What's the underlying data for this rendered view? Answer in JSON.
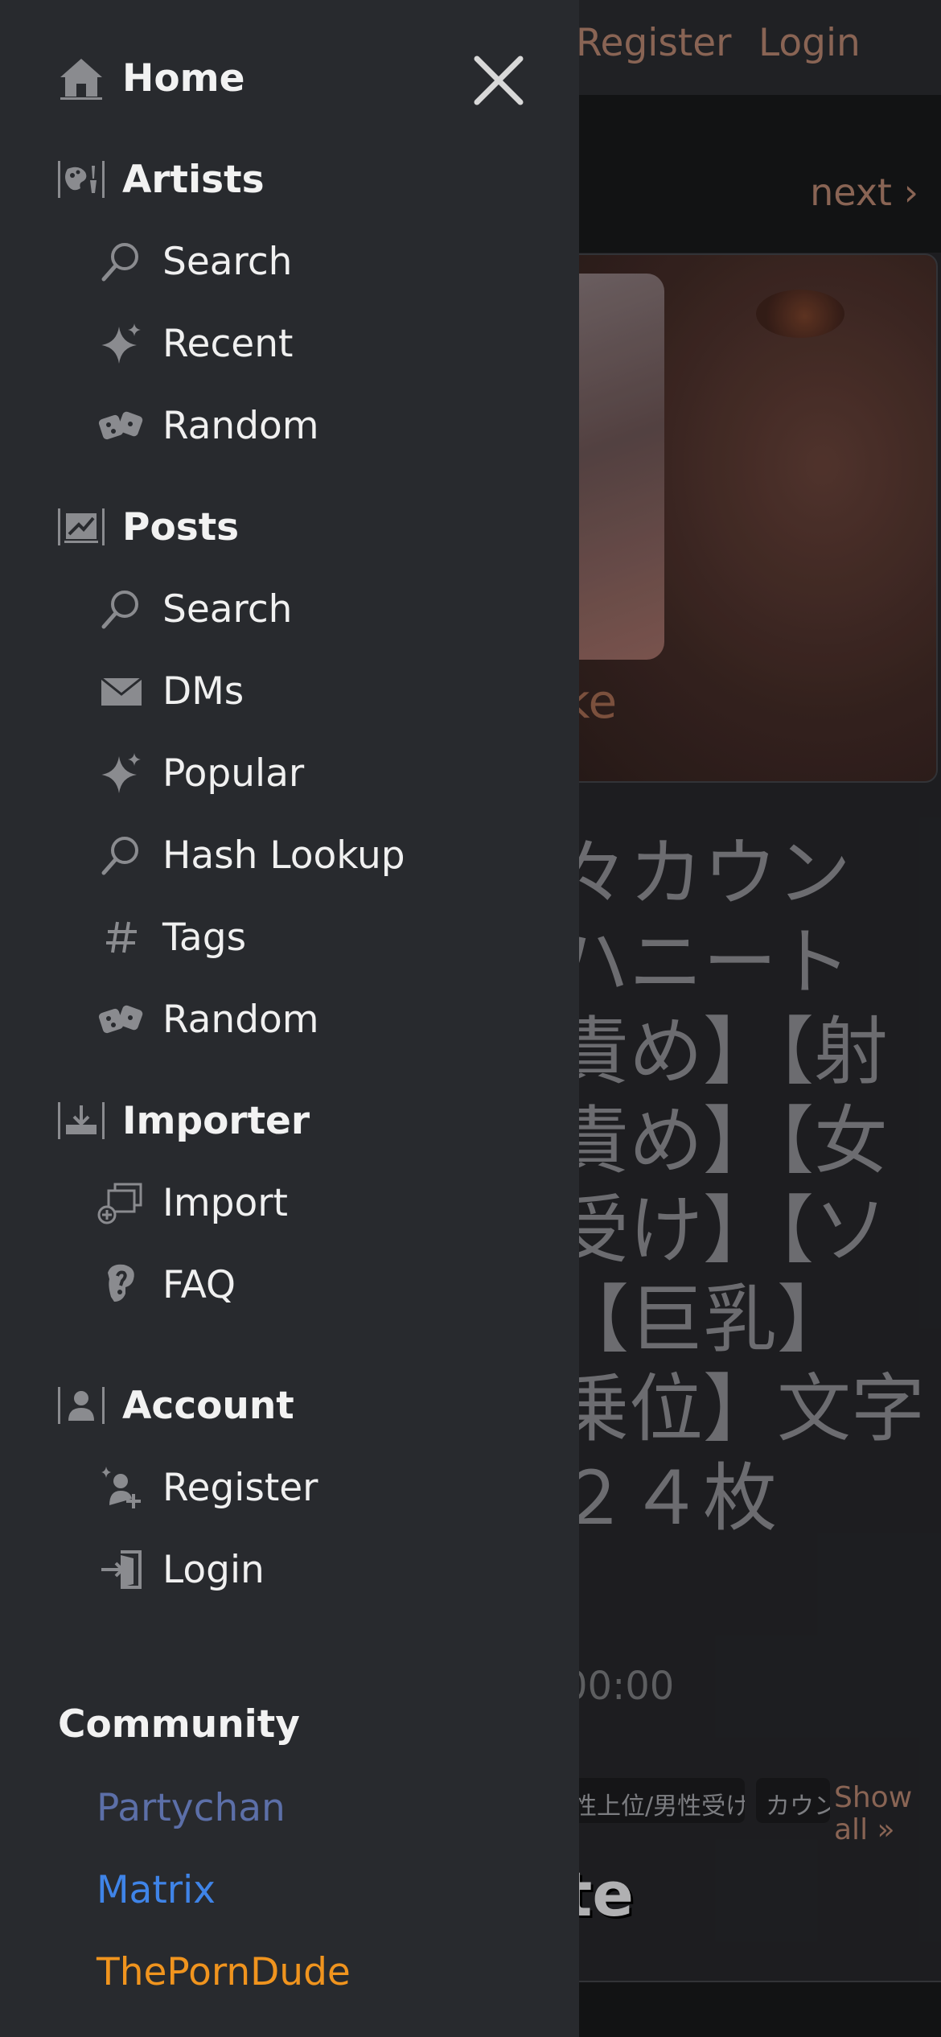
{
  "background": {
    "register_label": "Register",
    "login_label": "Login",
    "next_label": "next ›",
    "partial_text": "ke",
    "title_fragment": "々カウン\nハニート\n責め】【射\n責め】【女\n受け】【ソ\n【巨乳】\n乗位】文字\n２４枚",
    "time_fragment": "00:00",
    "tags": [
      "性上位/男性受け",
      "カウン"
    ],
    "show_all_label": "Show all »",
    "heading_fragment": "te"
  },
  "drawer": {
    "home": {
      "label": "Home",
      "icon": "home-icon"
    },
    "sections": [
      {
        "label": "Artists",
        "icon": "palette-icon",
        "items": [
          {
            "label": "Search",
            "icon": "search-icon"
          },
          {
            "label": "Recent",
            "icon": "sparkle-icon"
          },
          {
            "label": "Random",
            "icon": "dice-icon"
          }
        ]
      },
      {
        "label": "Posts",
        "icon": "chart-board-icon",
        "items": [
          {
            "label": "Search",
            "icon": "search-icon"
          },
          {
            "label": "DMs",
            "icon": "envelope-icon"
          },
          {
            "label": "Popular",
            "icon": "sparkle-icon"
          },
          {
            "label": "Hash Lookup",
            "icon": "search-icon"
          },
          {
            "label": "Tags",
            "icon": "hash-icon"
          },
          {
            "label": "Random",
            "icon": "dice-icon"
          }
        ]
      },
      {
        "label": "Importer",
        "icon": "download-tray-icon",
        "items": [
          {
            "label": "Import",
            "icon": "import-windows-icon"
          },
          {
            "label": "FAQ",
            "icon": "question-icon"
          }
        ]
      },
      {
        "label": "Account",
        "icon": "person-badge-icon",
        "items": [
          {
            "label": "Register",
            "icon": "add-user-icon"
          },
          {
            "label": "Login",
            "icon": "login-door-icon"
          }
        ]
      }
    ],
    "community": {
      "title": "Community",
      "links": [
        {
          "label": "Partychan",
          "color": "#5c6fa8"
        },
        {
          "label": "Matrix",
          "color": "#3f84e8"
        },
        {
          "label": "ThePornDude",
          "color": "#f0941e"
        }
      ]
    }
  },
  "colors": {
    "drawer_bg": "#282a2e",
    "icon_gray": "#8a8b8f",
    "accent_link": "#9c7260"
  }
}
